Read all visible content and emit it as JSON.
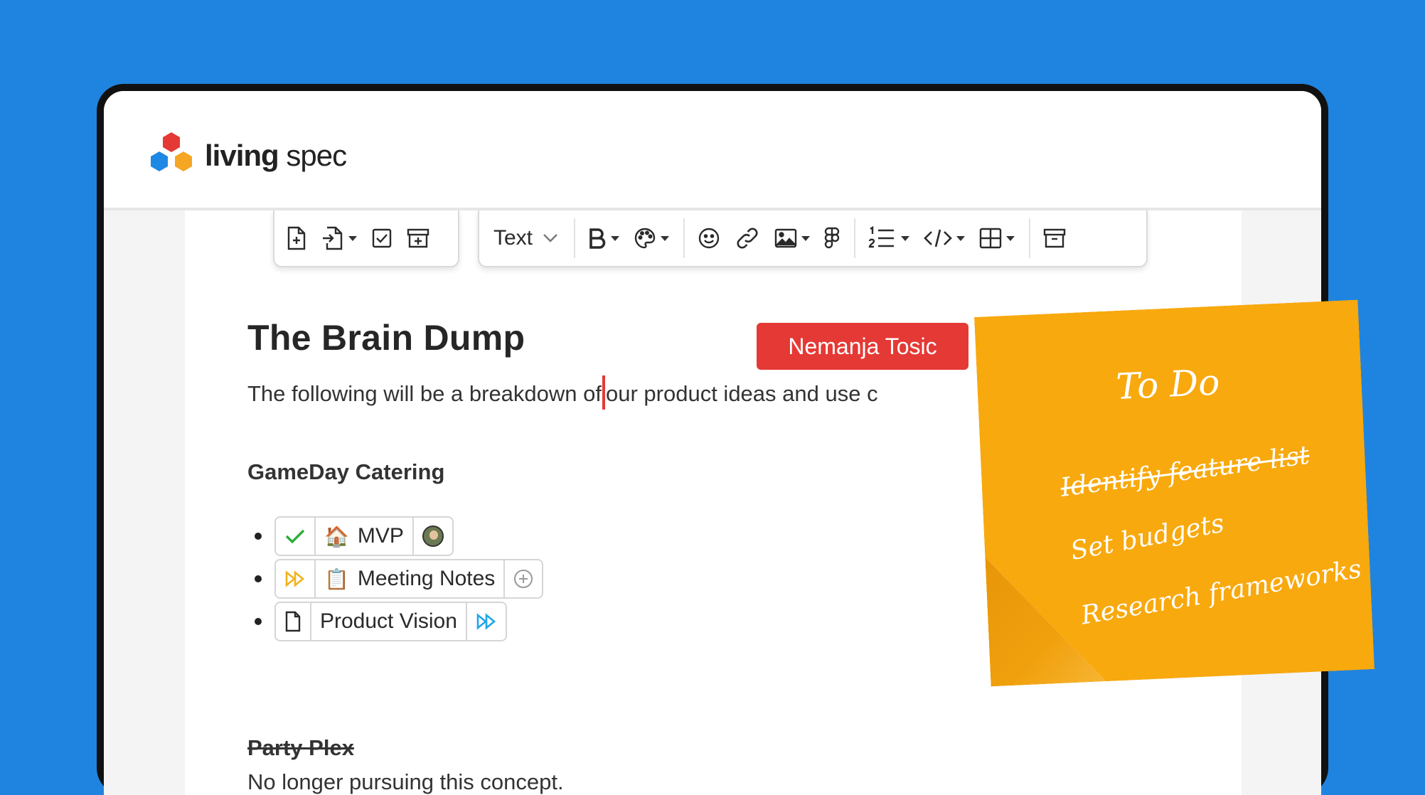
{
  "app": {
    "brand_bold": "living",
    "brand_light": " spec"
  },
  "toolbar": {
    "text_style": "Text"
  },
  "document": {
    "title": "The Brain Dump",
    "intro_before_cursor": "The following will be a breakdown of",
    "intro_after_cursor": "our product ideas and use c",
    "collaborator": "Nemanja Tosic",
    "section1": {
      "heading": "GameDay Catering",
      "items": [
        {
          "emoji": "🏠",
          "label": "MVP",
          "status": "checked"
        },
        {
          "emoji": "📋",
          "label": "Meeting Notes",
          "status": "in-progress"
        },
        {
          "label": "Product Vision",
          "status": "in-progress"
        }
      ]
    },
    "section2": {
      "heading": "Party Plex",
      "description": "No longer pursuing this concept."
    }
  },
  "sticky_note": {
    "title": "To Do",
    "items": [
      "Identify feature list",
      "Set budgets",
      "Research frameworks"
    ]
  },
  "colors": {
    "background": "#1F84DF",
    "accent_red": "#E53935",
    "sticky": "#F8A90E",
    "check_green": "#2EAD3A",
    "status_yellow": "#F2B21B",
    "status_blue": "#1EA7E8"
  }
}
